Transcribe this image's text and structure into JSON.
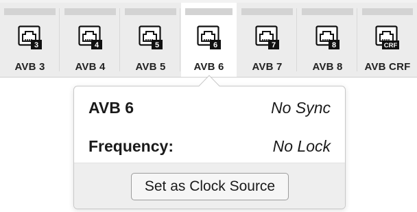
{
  "ports": [
    {
      "label": "AVB 3",
      "badge": "3",
      "selected": false
    },
    {
      "label": "AVB 4",
      "badge": "4",
      "selected": false
    },
    {
      "label": "AVB 5",
      "badge": "5",
      "selected": false
    },
    {
      "label": "AVB 6",
      "badge": "6",
      "selected": true
    },
    {
      "label": "AVB 7",
      "badge": "7",
      "selected": false
    },
    {
      "label": "AVB 8",
      "badge": "8",
      "selected": false
    },
    {
      "label": "AVB CRF",
      "badge": "CRF",
      "selected": false
    }
  ],
  "popover": {
    "title": "AVB 6",
    "sync_status": "No Sync",
    "frequency_label": "Frequency:",
    "frequency_value": "No Lock",
    "button_label": "Set as Clock Source"
  },
  "icon": "ethernet-port-icon"
}
